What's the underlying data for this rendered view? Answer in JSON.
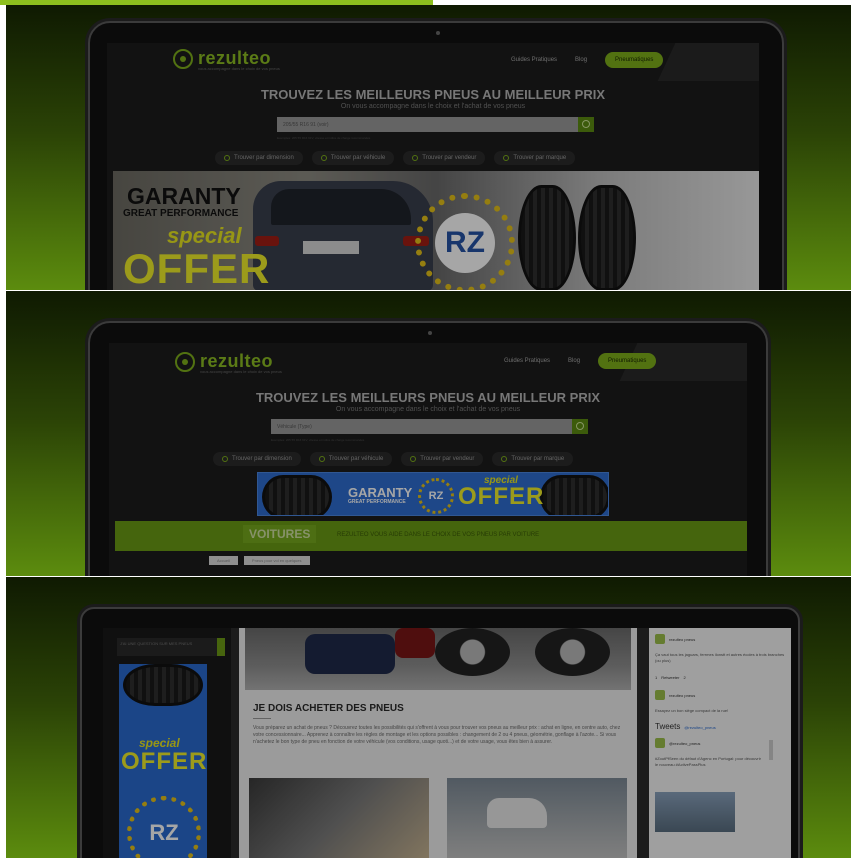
{
  "accent_color": "#8dbf1e",
  "site": {
    "logo_text": "rezulteo",
    "logo_tagline": "vous accompagne dans le choix de vos pneus",
    "nav": {
      "guides": "Guides Pratiques",
      "blog": "Blog",
      "cta": "Pneumatiques"
    },
    "hero_title": "TROUVEZ LES MEILLEURS PNEUS AU MEILLEUR PRIX",
    "hero_subtitle": "On vous accompagne dans le choix et l'achat de vos pneus",
    "search_value_1": "205/55 R16 91 (voir)",
    "search_value_2": "Véhicule (Type)",
    "search_hint": "Exemples: 205 55 R16 91V, vitesse et indice de charge recommandés",
    "filters": {
      "dimension": "Trouver par dimension",
      "vehicle": "Trouver par véhicule",
      "vendor": "Trouver par vendeur",
      "brand": "Trouver par marque"
    }
  },
  "banner": {
    "garanty": "GARANTY",
    "great_performance": "GREAT PERFORMANCE",
    "special": "special",
    "offer": "OFFER",
    "rz": "RZ"
  },
  "voitures": {
    "title": "VOITURES",
    "subtitle": "REZULTEO VOUS AIDE DANS LE CHOIX DE VOS PNEUS PAR VOITURE",
    "breadcrumb": [
      "Accueil",
      "Pneus pour voi en quelques"
    ]
  },
  "article": {
    "ask_question": "J'AI UNE QUESTION SUR MES PNEUS",
    "title": "JE DOIS ACHETER DES PNEUS",
    "body": "Vous préparez un achat de pneus ? Découvrez toutes les possibilités qui s'offrent à vous pour trouver vos pneus au meilleur prix : achat en ligne, en centre auto, chez votre concessionnaire... Apprenez à connaître les règles de montage et les options possibles : changement de 2 ou 4 pneus, géométrie, gonflage à l'azote... Si vous n'achetez le bon type de pneu en fonction de votre véhicule (vos conditions, usage quoti...) et de votre usage, vous êtes bien à assurer."
  },
  "twitter": {
    "account": "rezulteo pneus",
    "handle": "@rezulteo_pneus",
    "tweet1": "Ça vaut tous les jaguars, ferrmes ilonstt et autres écoles à trois branches (ou plus)",
    "actions": [
      "1",
      "Retweeter",
      "2"
    ],
    "tweet2": "Essayez un bon siège compact de la rue!",
    "header": "Tweets",
    "header_link": "@rezulteo_pneus",
    "tweet3": "#ZoutPfSeen du défaut d'Agenc en Portugal: pour découvrir le nouveau #ActivePassPlus"
  }
}
